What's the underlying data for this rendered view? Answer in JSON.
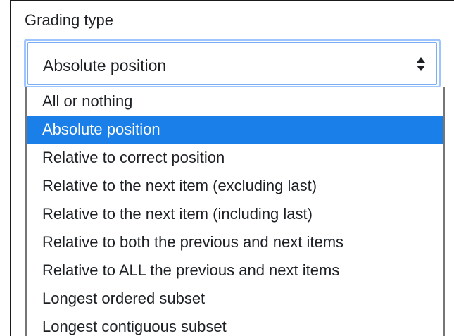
{
  "field": {
    "label": "Grading type",
    "selected_value": "Absolute position"
  },
  "dropdown": {
    "options": [
      {
        "label": "All or nothing",
        "selected": false
      },
      {
        "label": "Absolute position",
        "selected": true
      },
      {
        "label": "Relative to correct position",
        "selected": false
      },
      {
        "label": "Relative to the next item (excluding last)",
        "selected": false
      },
      {
        "label": "Relative to the next item (including last)",
        "selected": false
      },
      {
        "label": "Relative to both the previous and next items",
        "selected": false
      },
      {
        "label": "Relative to ALL the previous and next items",
        "selected": false
      },
      {
        "label": "Longest ordered subset",
        "selected": false
      },
      {
        "label": "Longest contiguous subset",
        "selected": false
      }
    ]
  },
  "colors": {
    "highlight": "#1a7fe8",
    "focus_ring": "#9ec5fe",
    "text": "#1d2125"
  },
  "icons": {
    "select_arrows": "sort-updown-icon"
  }
}
